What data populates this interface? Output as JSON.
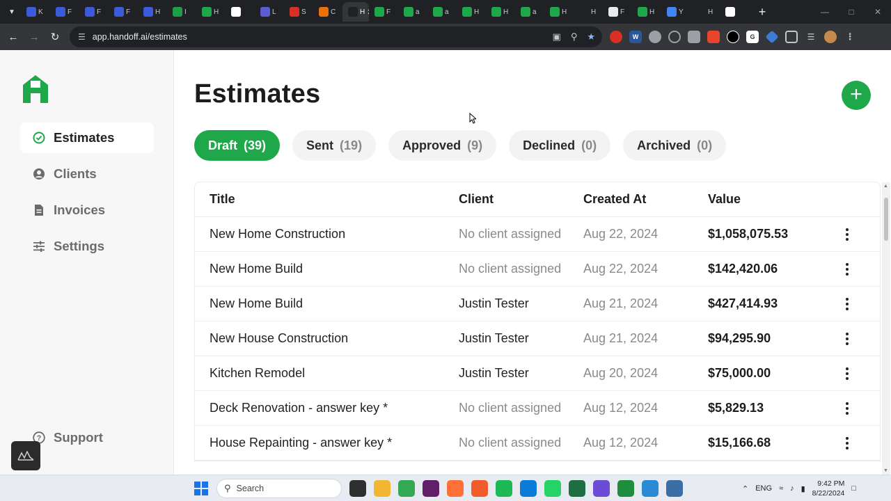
{
  "browser": {
    "url": "app.handoff.ai/estimates",
    "tabs": [
      {
        "label": "K",
        "color": "#3b5bdb"
      },
      {
        "label": "F",
        "color": "#3b5bdb"
      },
      {
        "label": "F",
        "color": "#3b5bdb"
      },
      {
        "label": "F",
        "color": "#3b5bdb"
      },
      {
        "label": "H",
        "color": "#3b5bdb"
      },
      {
        "label": "I",
        "color": "#1e9e46"
      },
      {
        "label": "H",
        "color": "#1fa849"
      },
      {
        "label": "",
        "color": "#ffffff"
      },
      {
        "label": "L",
        "color": "#5b5bd6"
      },
      {
        "label": "S",
        "color": "#d93025"
      },
      {
        "label": "C",
        "color": "#e8710a"
      },
      {
        "label": "H",
        "color": "#202124"
      },
      {
        "label": "F",
        "color": "#1fa849"
      },
      {
        "label": "a",
        "color": "#1fa849"
      },
      {
        "label": "a",
        "color": "#1fa849"
      },
      {
        "label": "H",
        "color": "#1fa849"
      },
      {
        "label": "H",
        "color": "#1fa849"
      },
      {
        "label": "a",
        "color": "#1fa849"
      },
      {
        "label": "H",
        "color": "#1fa849"
      },
      {
        "label": "H",
        "color": "#202124"
      },
      {
        "label": "F",
        "color": "#e8eaed"
      },
      {
        "label": "H",
        "color": "#1fa849"
      },
      {
        "label": "Y",
        "color": "#4285f4"
      },
      {
        "label": "H",
        "color": "#202124"
      },
      {
        "label": "",
        "color": "#ffffff"
      }
    ],
    "active_tab_index": 11
  },
  "sidebar": {
    "brand_color": "#1fa849",
    "items": [
      {
        "label": "Estimates",
        "icon": "check-circle-icon",
        "active": true
      },
      {
        "label": "Clients",
        "icon": "user-circle-icon",
        "active": false
      },
      {
        "label": "Invoices",
        "icon": "document-icon",
        "active": false
      },
      {
        "label": "Settings",
        "icon": "sliders-icon",
        "active": false
      }
    ],
    "support_label": "Support"
  },
  "main": {
    "title": "Estimates",
    "add_icon": "plus-icon",
    "status_tabs": [
      {
        "label": "Draft",
        "count": "(39)",
        "active": true
      },
      {
        "label": "Sent",
        "count": "(19)",
        "active": false
      },
      {
        "label": "Approved",
        "count": "(9)",
        "active": false
      },
      {
        "label": "Declined",
        "count": "(0)",
        "active": false
      },
      {
        "label": "Archived",
        "count": "(0)",
        "active": false
      }
    ],
    "table": {
      "headers": {
        "title": "Title",
        "client": "Client",
        "created_at": "Created At",
        "value": "Value"
      },
      "rows": [
        {
          "title": "New Home Construction",
          "client": "No client assigned",
          "created_at": "Aug 22, 2024",
          "value": "$1,058,075.53",
          "has_client": false
        },
        {
          "title": "New Home Build",
          "client": "No client assigned",
          "created_at": "Aug 22, 2024",
          "value": "$142,420.06",
          "has_client": false
        },
        {
          "title": "New Home Build",
          "client": "Justin Tester",
          "created_at": "Aug 21, 2024",
          "value": "$427,414.93",
          "has_client": true
        },
        {
          "title": "New House Construction",
          "client": "Justin Tester",
          "created_at": "Aug 21, 2024",
          "value": "$94,295.90",
          "has_client": true
        },
        {
          "title": "Kitchen Remodel",
          "client": "Justin Tester",
          "created_at": "Aug 20, 2024",
          "value": "$75,000.00",
          "has_client": true
        },
        {
          "title": "Deck Renovation - answer key *",
          "client": "No client assigned",
          "created_at": "Aug 12, 2024",
          "value": "$5,829.13",
          "has_client": false
        },
        {
          "title": "House Repainting - answer key *",
          "client": "No client assigned",
          "created_at": "Aug 12, 2024",
          "value": "$15,166.68",
          "has_client": false
        }
      ]
    }
  },
  "taskbar": {
    "search_placeholder": "Search",
    "language": "ENG",
    "time": "9:42 PM",
    "date": "8/22/2024",
    "apps": [
      {
        "name": "task-view",
        "color": "#2f2f2f"
      },
      {
        "name": "file-explorer",
        "color": "#f2b632"
      },
      {
        "name": "chrome",
        "color": "#34a853"
      },
      {
        "name": "slack",
        "color": "#611f69"
      },
      {
        "name": "firefox",
        "color": "#ff7139"
      },
      {
        "name": "app-orange",
        "color": "#f25c2a"
      },
      {
        "name": "spotify",
        "color": "#1db954"
      },
      {
        "name": "edge",
        "color": "#0c7bd8"
      },
      {
        "name": "whatsapp",
        "color": "#25d366"
      },
      {
        "name": "excel",
        "color": "#1d6f42"
      },
      {
        "name": "app-purple",
        "color": "#6c4bd6"
      },
      {
        "name": "app-green",
        "color": "#1e8e3e"
      },
      {
        "name": "snipping",
        "color": "#2a8bd4"
      },
      {
        "name": "calculator",
        "color": "#3a6ea5"
      }
    ]
  }
}
